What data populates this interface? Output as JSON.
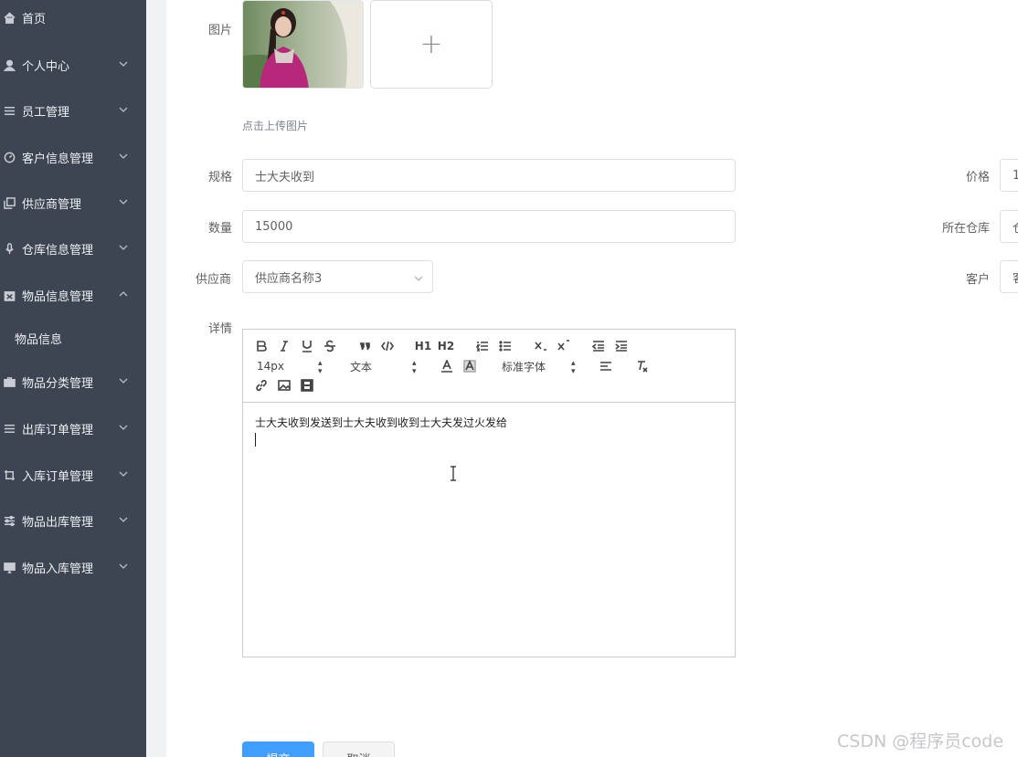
{
  "sidebar": {
    "items": [
      {
        "label": "首页",
        "icon": "home-icon",
        "arrow": ""
      },
      {
        "label": "个人中心",
        "icon": "user-icon",
        "arrow": "down"
      },
      {
        "label": "员工管理",
        "icon": "list-icon",
        "arrow": "down"
      },
      {
        "label": "客户信息管理",
        "icon": "compass-icon",
        "arrow": "down"
      },
      {
        "label": "供应商管理",
        "icon": "copy-icon",
        "arrow": "down"
      },
      {
        "label": "仓库信息管理",
        "icon": "microphone-icon",
        "arrow": "down"
      },
      {
        "label": "物品信息管理",
        "icon": "box-icon",
        "arrow": "up"
      },
      {
        "label": "物品分类管理",
        "icon": "briefcase-icon",
        "arrow": "down"
      },
      {
        "label": "出库订单管理",
        "icon": "list-icon",
        "arrow": "down"
      },
      {
        "label": "入库订单管理",
        "icon": "crop-icon",
        "arrow": "down"
      },
      {
        "label": "物品出库管理",
        "icon": "sliders-icon",
        "arrow": "down"
      },
      {
        "label": "物品入库管理",
        "icon": "monitor-icon",
        "arrow": "down"
      }
    ],
    "sub_item": "物品信息"
  },
  "form": {
    "image_label": "图片",
    "upload_plus": "+",
    "upload_tip": "点击上传图片",
    "spec_label": "规格",
    "spec_value": "士大夫收到",
    "price_label": "价格",
    "price_value": "1",
    "quantity_label": "数量",
    "quantity_value": "15000",
    "warehouse_label": "所在仓库",
    "warehouse_value": "仓",
    "supplier_label": "供应商",
    "supplier_value": "供应商名称3",
    "customer_label": "客户",
    "customer_value": "客",
    "detail_label": "详情"
  },
  "editor": {
    "font_size": "14px",
    "paragraph": "文本",
    "font_family": "标准字体",
    "h1": "H1",
    "h2": "H2",
    "content": "士大夫收到发送到士大夫收到收到士大夫发过火发给"
  },
  "buttons": {
    "submit": "提交",
    "cancel": "取消"
  },
  "watermark": "CSDN @程序员code"
}
